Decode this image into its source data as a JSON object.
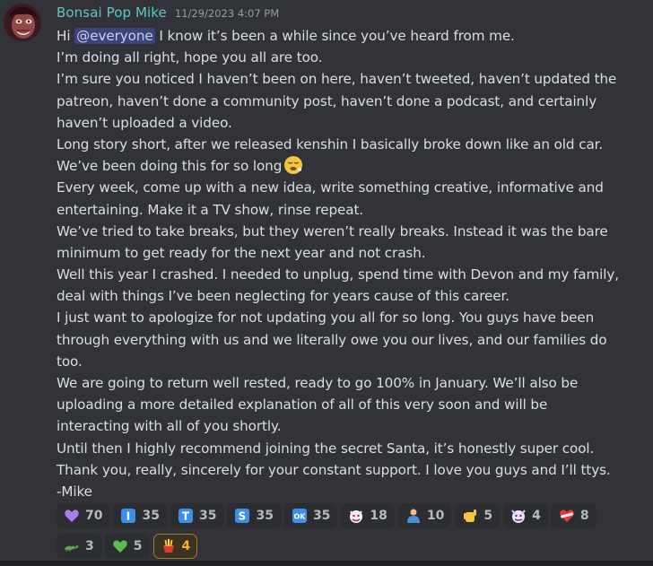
{
  "author": "Bonsai Pop Mike",
  "timestamp": "11/29/2023 4:07 PM",
  "mention": "@everyone",
  "line1_prefix": "Hi ",
  "line1_suffix": " I know it’s been a while since you’ve heard from me.",
  "lines": [
    "I’m doing all right, hope you all are too.",
    "I’m sure you noticed I haven’t been on here, haven’t tweeted, haven’t updated the",
    "patreon, haven’t done a community post, haven’t done a podcast, and certainly",
    "haven’t uploaded a video.",
    "Long story short, after we released kenshin I basically broke down like an old car.",
    "We’ve been doing this for so long",
    "Every week, come up with a new idea, write something creative, informative and",
    "entertaining. Make it a TV show, rinse repeat.",
    "We’ve tried to take breaks, but they weren’t really breaks. Instead it was the bare",
    "minimum to get ready for the next year and not crash.",
    "Well this year I crashed. I needed to unplug, spend time with Devon and my family,",
    "deal with things I’ve been neglecting for years cause of this career.",
    "I just want to apologize for not updating you all for so long. You guys have been",
    "through everything with us and we literally owe you our lives, and our families do",
    "too.",
    "We are going to return well rested, ready to go 100% in January. We’ll also be",
    "uploading a more detailed explanation of all of this very soon and will be",
    "interacting with all of you shortly.",
    "Until then I highly recommend joining the secret Santa, it’s honestly super cool.",
    "Thank you, really, sincerely for your constant support. I love you guys and I’ll ttys.",
    "-Mike"
  ],
  "inline_emoji": "tired-face-emoji",
  "reactions": [
    {
      "emoji": "purple-heart",
      "count": "70"
    },
    {
      "emoji": "letter-i",
      "glyph": "I",
      "count": "35"
    },
    {
      "emoji": "letter-t",
      "glyph": "T",
      "count": "35"
    },
    {
      "emoji": "letter-s",
      "glyph": "S",
      "count": "35"
    },
    {
      "emoji": "ok-button",
      "glyph": "OK",
      "count": "35"
    },
    {
      "emoji": "oni-mask",
      "count": "18"
    },
    {
      "emoji": "man-in-shirt",
      "count": "10"
    },
    {
      "emoji": "call-me-hand",
      "count": "5"
    },
    {
      "emoji": "demon-mask",
      "count": "4"
    },
    {
      "emoji": "heart-bandage",
      "count": "8"
    },
    {
      "emoji": "crocodile",
      "count": "3"
    },
    {
      "emoji": "green-heart",
      "count": "5"
    },
    {
      "emoji": "fries-custom",
      "count": "4",
      "me": true
    }
  ],
  "colors": {
    "background": "#313338",
    "author": "#5fc7c1",
    "timestamp": "#949ba4",
    "mention_bg": "#5865f2",
    "reaction_bg": "#2b2d31",
    "reaction_me_border": "#a07a2a",
    "reaction_me_text": "#f0b232"
  }
}
